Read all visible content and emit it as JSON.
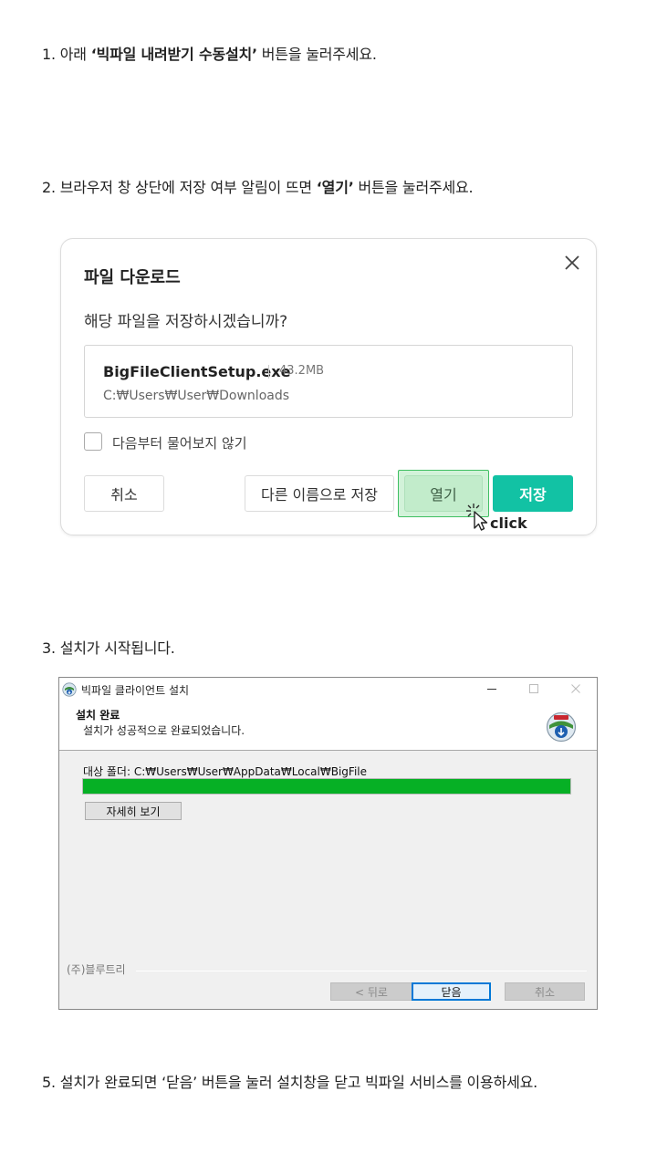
{
  "steps": {
    "step1": {
      "prefix": "1. 아래 ",
      "highlight": "‘빅파일 내려받기 수동설치’",
      "suffix": " 버튼을 눌러주세요."
    },
    "step2": {
      "prefix": "2. 브라우저 창 상단에 저장 여부 알림이 뜨면 ",
      "highlight": "‘열기’",
      "suffix": " 버튼을 눌러주세요."
    },
    "step3": {
      "text": "3. 설치가 시작됩니다."
    },
    "step5": {
      "text": "5. 설치가 완료되면 ‘닫음’ 버튼을 눌러 설치창을 닫고 빅파일 서비스를 이용하세요."
    }
  },
  "download_dialog": {
    "title": "파일 다운로드",
    "question": "해당 파일을 저장하시겠습니까?",
    "file_name": "BigFileClientSetup.exe",
    "file_size": "43.2MB",
    "file_path": "C:₩Users₩User₩Downloads",
    "checkbox_label": "다음부터 물어보지 않기",
    "buttons": {
      "cancel": "취소",
      "rename": "다른 이름으로 저장",
      "open": "열기",
      "save": "저장"
    },
    "click_label": "click",
    "accent_color": "#12c2a4",
    "highlight_color": "#3fbf62",
    "icons": {
      "close": "close-icon",
      "cursor": "cursor-click-icon"
    }
  },
  "installer": {
    "window_title": "빅파일 클라이언트 설치",
    "header_title": "설치 완료",
    "header_subtitle": "설치가 성공적으로 완료되었습니다.",
    "folder_label": "대상 폴더: C:₩Users₩User₩AppData₩Local₩BigFile",
    "progress_percent": 100,
    "progress_color": "#06b025",
    "details_button": "자세히 보기",
    "company": "(주)블루트리",
    "buttons": {
      "back": "< 뒤로",
      "close": "닫음",
      "cancel": "취소"
    },
    "icons": {
      "logo": "bigfile-logo-icon",
      "minimize": "minimize-icon",
      "maximize": "maximize-icon",
      "close": "close-icon"
    }
  }
}
